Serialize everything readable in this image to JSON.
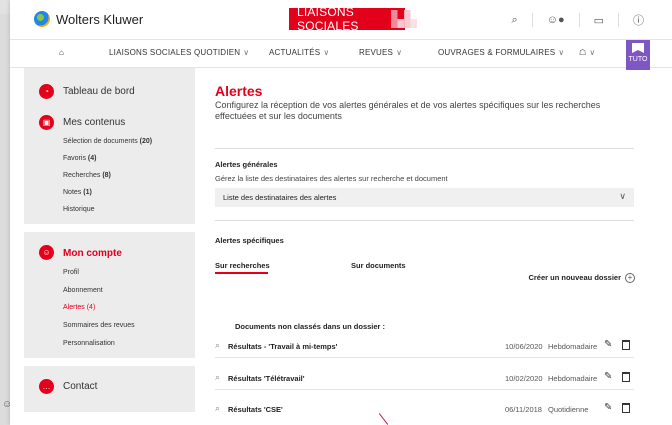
{
  "header": {
    "logo_text": "Wolters Kluwer",
    "brand": "LIAISONS SOCIALES",
    "icons": [
      "search-icon",
      "user-icon",
      "folder-icon",
      "help-icon"
    ],
    "accent": "#e3001b"
  },
  "nav": {
    "items": [
      {
        "label": "LIAISONS SOCIALES QUOTIDIEN"
      },
      {
        "label": "ACTUALITÉS"
      },
      {
        "label": "REVUES"
      },
      {
        "label": "OUVRAGES & FORMULAIRES"
      }
    ],
    "tuto": "TUTO"
  },
  "sidebar": {
    "dashboard": "Tableau de bord",
    "contents_title": "Mes contenus",
    "contents": [
      {
        "label": "Sélection de documents",
        "count": "(20)"
      },
      {
        "label": "Favoris",
        "count": "(4)"
      },
      {
        "label": "Recherches",
        "count": "(8)"
      },
      {
        "label": "Notes",
        "count": "(1)"
      },
      {
        "label": "Historique",
        "count": ""
      }
    ],
    "account_title": "Mon compte",
    "account": [
      {
        "label": "Profil"
      },
      {
        "label": "Abonnement"
      },
      {
        "label": "Alertes (4)"
      },
      {
        "label": "Sommaires des revues"
      },
      {
        "label": "Personnalisation"
      }
    ],
    "contact": "Contact"
  },
  "main": {
    "title": "Alertes",
    "description": "Configurez la réception de vos alertes générales et de vos alertes spécifiques sur les recherches effectuées et sur les documents",
    "general_title": "Alertes générales",
    "general_sub": "Gérez la liste des destinataires des alertes sur recherche et document",
    "select_value": "Liste des destinataires des alertes",
    "specific_title": "Alertes spécifiques",
    "tab_searches": "Sur recherches",
    "tab_documents": "Sur documents",
    "create_folder": "Créer un nouveau dossier",
    "group_title": "Documents non classés dans un dossier :",
    "rows": [
      {
        "label": "Résultats - 'Travail à mi-temps'",
        "date": "10/06/2020",
        "freq": "Hebdomadaire"
      },
      {
        "label": "Résultats 'Télétravail'",
        "date": "10/02/2020",
        "freq": "Hebdomadaire"
      },
      {
        "label": "Résultats 'CSE'",
        "date": "06/11/2018",
        "freq": "Quotidienne"
      }
    ]
  }
}
